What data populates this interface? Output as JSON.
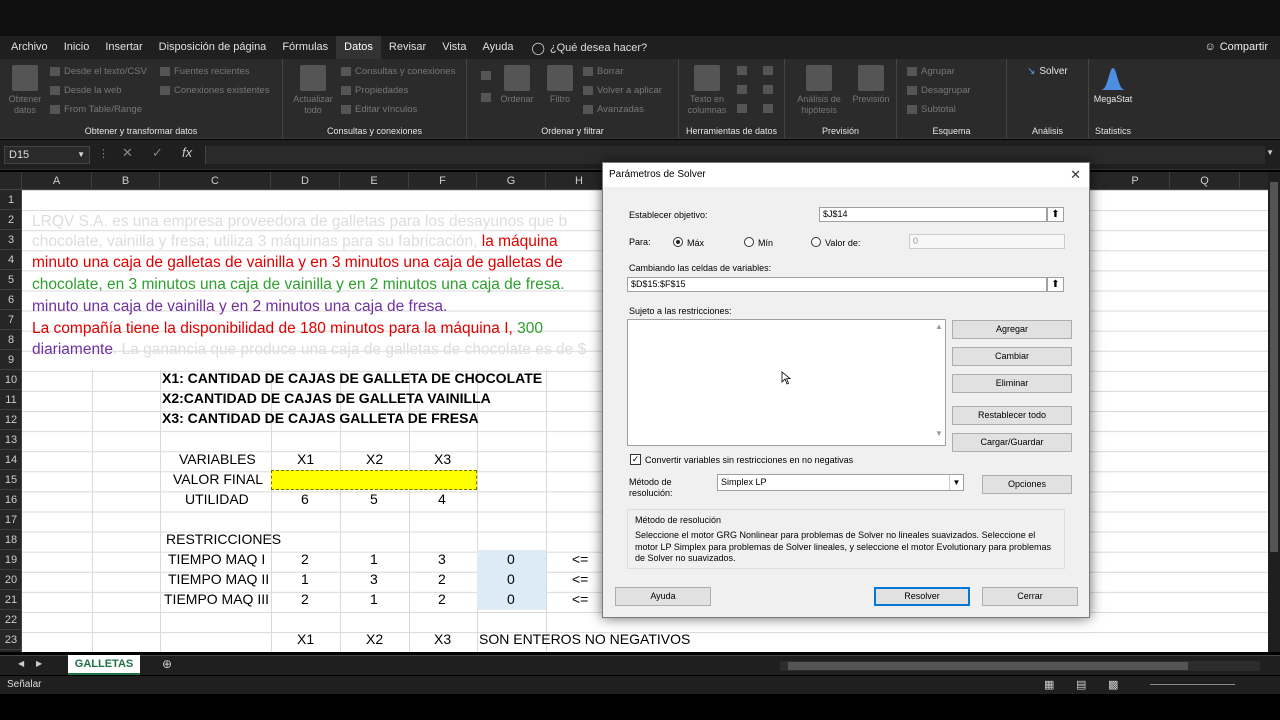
{
  "ribbon_tabs": [
    "Archivo",
    "Inicio",
    "Insertar",
    "Disposición de página",
    "Fórmulas",
    "Datos",
    "Revisar",
    "Vista",
    "Ayuda"
  ],
  "active_tab": "Datos",
  "tell_me": "¿Qué desea hacer?",
  "share": "Compartir",
  "ribbon": {
    "get_transform": {
      "label": "Obtener y transformar datos",
      "big": "Obtener\ndatos",
      "items": [
        "Desde el texto/CSV",
        "Desde la web",
        "From Table/Range",
        "Fuentes recientes",
        "Conexiones existentes"
      ]
    },
    "queries": {
      "label": "Consultas y conexiones",
      "big": "Actualizar\ntodo",
      "items": [
        "Consultas y conexiones",
        "Propiedades",
        "Editar vínculos"
      ]
    },
    "sort_filter": {
      "label": "Ordenar y filtrar",
      "sort": "Ordenar",
      "filter": "Filtro",
      "items": [
        "Borrar",
        "Volver a aplicar",
        "Avanzadas"
      ]
    },
    "data_tools": {
      "label": "Herramientas de datos",
      "big": "Texto en\ncolumnas"
    },
    "forecast": {
      "label": "Previsión",
      "whatif": "Análisis de\nhipótesis",
      "forecast_sheet": "Previsión"
    },
    "outline": {
      "label": "Esquema",
      "items": [
        "Agrupar",
        "Desagrupar",
        "Subtotal"
      ]
    },
    "analysis": {
      "label": "Análisis",
      "solver": "Solver"
    },
    "statistics": {
      "label": "Statistics",
      "megastat": "MegaStat"
    }
  },
  "name_box": "D15",
  "columns": [
    "A",
    "B",
    "C",
    "D",
    "E",
    "F",
    "G",
    "H",
    "P",
    "Q"
  ],
  "rows": [
    "1",
    "2",
    "3",
    "4",
    "5",
    "6",
    "7",
    "8",
    "9",
    "10",
    "11",
    "12",
    "13",
    "14",
    "15",
    "16",
    "17",
    "18",
    "19",
    "20",
    "21",
    "22",
    "23"
  ],
  "sheet": {
    "line2": "LRQV S.A. es una empresa proveedora de galletas para los desayunos que b",
    "line3a": "chocolate, vainilla y fresa; utiliza 3 máquinas para su fabricación, ",
    "line3b": "la máquina",
    "line4": "minuto una caja de galletas de vainilla  y en 3 minutos una caja de galletas de",
    "line5": "chocolate, en 3 minutos una caja de vainilla y en 2 minutos una caja de fresa.",
    "line6": "minuto una caja de vainilla y en 2 minutos una caja de fresa.",
    "line8a": "La compañía tiene la disponibilidad de 180 minutos para la máquina I, ",
    "line8b": "300",
    "line9a": "diariamente",
    "line9b": ". La ganancia que produce una caja de galletas de chocolate es de $",
    "x1def": "X1: CANTIDAD DE CAJAS DE GALLETA DE CHOCOLATE",
    "x2def": "X2:CANTIDAD DE CAJAS DE GALLETA VAINILLA",
    "x3def": "X3: CANTIDAD DE CAJAS GALLETA DE FRESA",
    "variables": "VARIABLES",
    "x1": "X1",
    "x2": "X2",
    "x3": "X3",
    "valor_final": "VALOR FINAL",
    "utilidad": "UTILIDAD",
    "util": [
      "6",
      "5",
      "4"
    ],
    "restricciones": "RESTRICCIONES",
    "constraints": [
      {
        "name": "TIEMPO MAQ I",
        "values": [
          "2",
          "1",
          "3"
        ],
        "lhs": "0",
        "op": "<="
      },
      {
        "name": "TIEMPO MAQ II",
        "values": [
          "1",
          "3",
          "2"
        ],
        "lhs": "0",
        "op": "<="
      },
      {
        "name": "TIEMPO MAQ III",
        "values": [
          "2",
          "1",
          "2"
        ],
        "lhs": "0",
        "op": "<="
      }
    ],
    "enteros": "SON ENTEROS NO NEGATIVOS"
  },
  "sheet_tab": "GALLETAS",
  "status": "Señalar",
  "dialog": {
    "title": "Parámetros de Solver",
    "objective_label": "Establecer objetivo:",
    "objective": "$J$14",
    "para": "Para:",
    "max": "Máx",
    "min": "Mín",
    "valor_de": "Valor de:",
    "valor": "0",
    "changing_label": "Cambiando las celdas de variables:",
    "changing": "$D$15:$F$15",
    "subject_label": "Sujeto a las restricciones:",
    "agregar": "Agregar",
    "cambiar": "Cambiar",
    "eliminar": "Eliminar",
    "restablecer": "Restablecer todo",
    "cargar": "Cargar/Guardar",
    "nonneg": "Convertir variables sin restricciones en no negativas",
    "method_label": "Método de\nresolución:",
    "method": "Simplex LP",
    "opciones": "Opciones",
    "method_title": "Método de resolución",
    "method_desc": "Seleccione el motor GRG Nonlinear para problemas de Solver no lineales suavizados. Seleccione el motor LP Simplex para problemas de Solver lineales, y seleccione el motor Evolutionary para problemas de Solver no suavizados.",
    "ayuda": "Ayuda",
    "resolver": "Resolver",
    "cerrar": "Cerrar"
  }
}
